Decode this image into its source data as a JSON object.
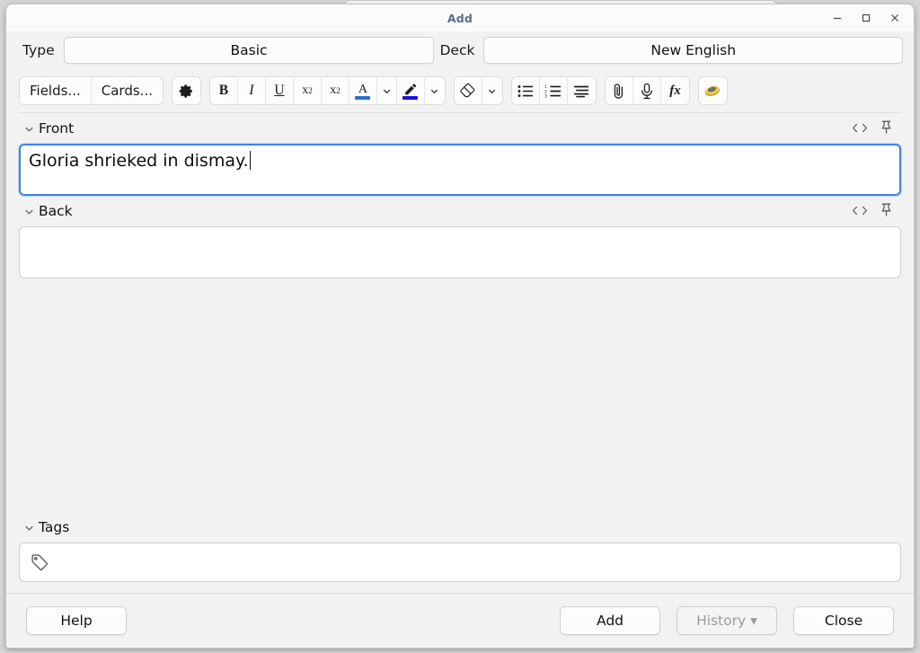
{
  "window": {
    "title": "Add",
    "controls": [
      {
        "name": "minimize",
        "glyph": "minimize-icon"
      },
      {
        "name": "maximize",
        "glyph": "maximize-icon"
      },
      {
        "name": "close",
        "glyph": "close-icon"
      }
    ]
  },
  "selectors": {
    "type_label": "Type",
    "type_value": "Basic",
    "deck_label": "Deck",
    "deck_value": "New English"
  },
  "toolbar": {
    "fields_label": "Fields...",
    "cards_label": "Cards...",
    "settings_icon": "gear-icon",
    "bold_label": "B",
    "italic_label": "I",
    "underline_label": "U",
    "superscript_label": "x",
    "superscript_exp": "2",
    "subscript_label": "x",
    "subscript_exp": "2",
    "text_color_glyph": "A",
    "text_color": "#2d6fc9",
    "highlight_color": "#1d0fe0",
    "eraser_icon": "eraser-icon",
    "bullet_list_icon": "bullet-list-icon",
    "numbered_list_icon": "numbered-list-icon",
    "align_icon": "text-align-icon",
    "attach_icon": "paperclip-icon",
    "record_icon": "microphone-icon",
    "mathjax_label": "fx",
    "sticky_icon": "cloze-icon"
  },
  "fields": [
    {
      "name": "Front",
      "value": "Gloria shrieked in dismay.",
      "focused": true,
      "html_icon": "html-editor-icon",
      "pin_icon": "pin-icon"
    },
    {
      "name": "Back",
      "value": "",
      "focused": false,
      "html_icon": "html-editor-icon",
      "pin_icon": "pin-icon"
    }
  ],
  "tags": {
    "label": "Tags",
    "value": "",
    "icon": "tag-icon"
  },
  "bottom": {
    "help_label": "Help",
    "add_label": "Add",
    "history_label": "History ▾",
    "history_disabled": true,
    "close_label": "Close"
  }
}
